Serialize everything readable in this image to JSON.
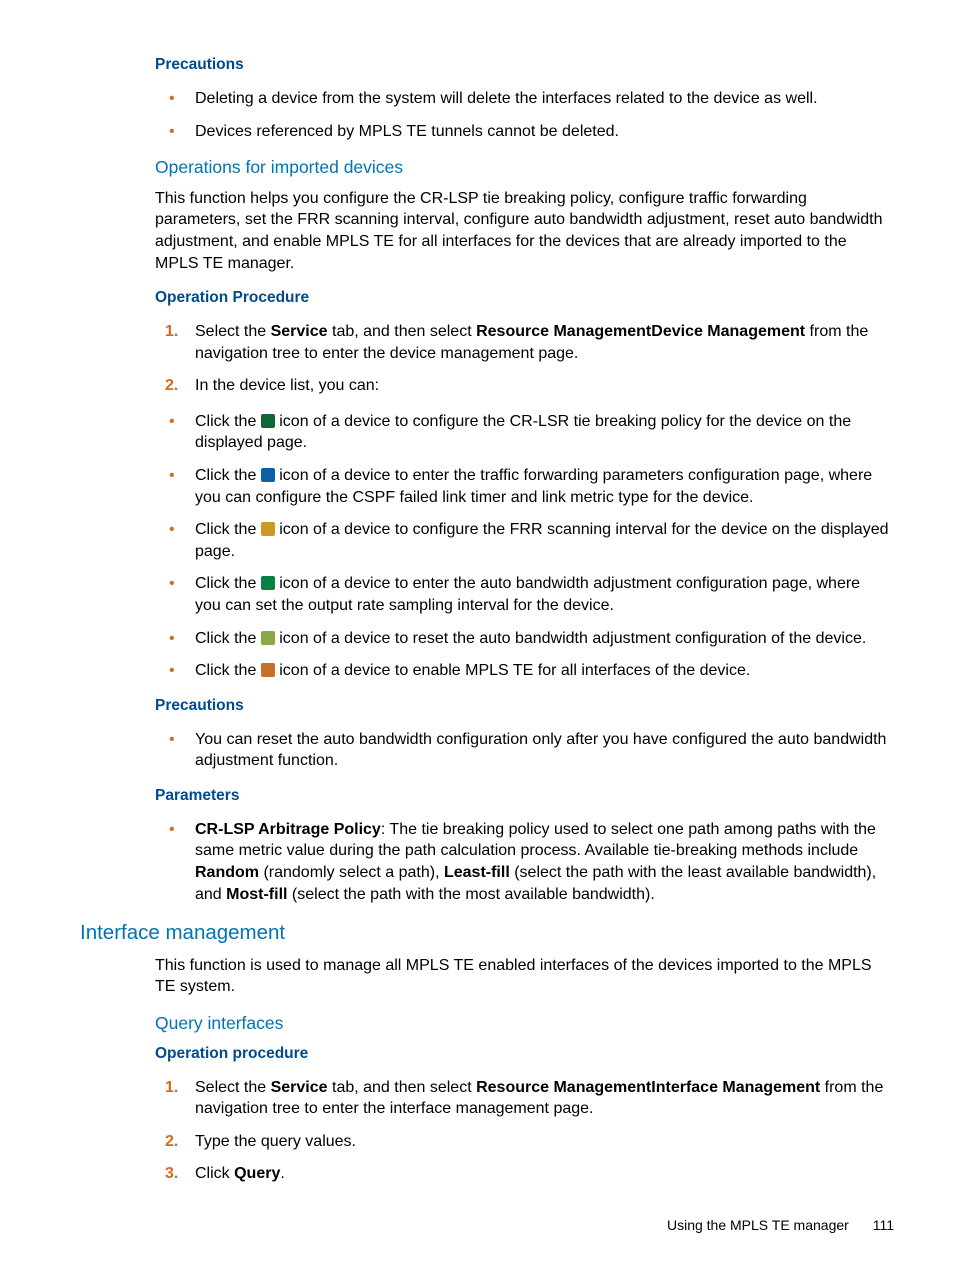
{
  "sec1": {
    "heading": "Precautions",
    "b1": "Deleting a device from the system will delete the interfaces related to the device as well.",
    "b2": "Devices referenced by MPLS TE tunnels cannot be deleted."
  },
  "sec2": {
    "heading": "Operations for imported devices",
    "body": "This function helps you configure the CR-LSP tie breaking policy, configure traffic forwarding parameters, set the FRR scanning interval, configure auto bandwidth adjustment, reset auto bandwidth adjustment, and enable MPLS TE for all interfaces for the devices that are already imported to the MPLS TE manager."
  },
  "sec3": {
    "heading": "Operation Procedure",
    "s1a": "Select the ",
    "s1b": "Service",
    "s1c": " tab, and then select ",
    "s1d": "Resource Management",
    "s1e": "Device Management",
    "s1f": " from the navigation tree to enter the device management page.",
    "s2": "In the device list, you can:",
    "b1a": "Click the ",
    "b1b": " icon of a device to configure the CR-LSR tie breaking policy for the device on the displayed page.",
    "b2a": "Click the ",
    "b2b": " icon of a device to enter the traffic forwarding parameters configuration page, where you can configure the CSPF failed link timer and link metric type for the device.",
    "b3a": "Click the ",
    "b3b": " icon of a device to configure the FRR scanning interval for the device on the displayed page.",
    "b4a": "Click the ",
    "b4b": " icon of a device to enter the auto bandwidth adjustment configuration page, where you can set the output rate sampling interval for the device.",
    "b5a": "Click the ",
    "b5b": " icon of a device to reset the auto bandwidth adjustment configuration of the device.",
    "b6a": "Click the ",
    "b6b": " icon of a device to enable MPLS TE for all interfaces of the device."
  },
  "sec4": {
    "heading": "Precautions",
    "b1": "You can reset the auto bandwidth configuration only after you have configured the auto bandwidth adjustment function."
  },
  "sec5": {
    "heading": "Parameters",
    "b1a": "CR-LSP Arbitrage Policy",
    "b1b": ": The tie breaking policy used to select one path among paths with the same metric value during the path calculation process. Available tie-breaking methods include ",
    "b1c": "Random",
    "b1d": " (randomly select a path), ",
    "b1e": "Least-fill",
    "b1f": " (select the path with the least available bandwidth), and ",
    "b1g": "Most-fill",
    "b1h": " (select the path with the most available bandwidth)."
  },
  "sec6": {
    "heading": "Interface management",
    "body": "This function is used to manage all MPLS TE enabled interfaces of the devices imported to the MPLS TE system."
  },
  "sec7": {
    "heading": "Query interfaces"
  },
  "sec8": {
    "heading": "Operation procedure",
    "s1a": "Select the ",
    "s1b": "Service",
    "s1c": " tab, and then select ",
    "s1d": "Resource Management",
    "s1e": "Interface Management",
    "s1f": " from the navigation tree to enter the interface management page.",
    "s2": "Type the query values.",
    "s3a": "Click ",
    "s3b": "Query",
    "s3c": "."
  },
  "footer": {
    "text": "Using the MPLS TE manager",
    "page": "111"
  }
}
